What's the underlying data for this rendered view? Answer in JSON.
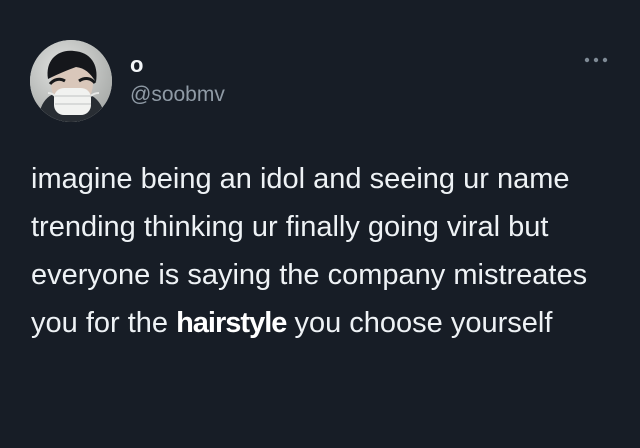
{
  "tweet": {
    "author": {
      "display_name": "o",
      "handle": "@soobmv",
      "avatar_icon": "profile-photo-masked-person"
    },
    "text_before": "imagine being an idol and seeing ur name trending thinking ur finally going viral but everyone is saying the company mistreates you for the ",
    "text_emphasis": "hairstyle",
    "text_after": " you choose yourself",
    "more_icon": "more-options-icon"
  },
  "colors": {
    "background": "#171d26",
    "text": "#eef2f5",
    "muted": "#8f9aa5"
  }
}
